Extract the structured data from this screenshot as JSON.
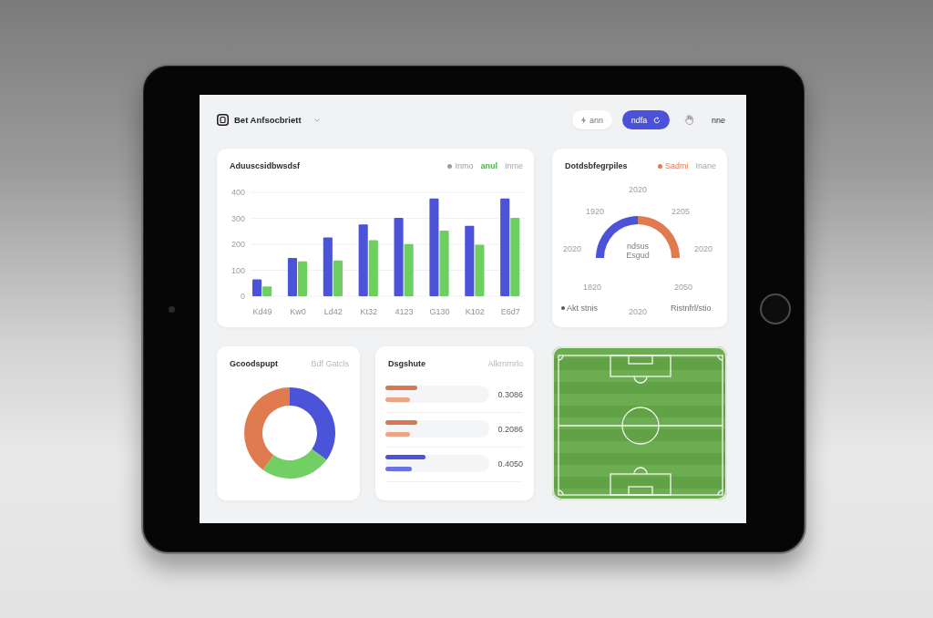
{
  "header": {
    "title": "Bet Anfsocbriett",
    "filter_button": {
      "label": "ann"
    },
    "primary_button": {
      "label": "ndfa"
    },
    "menu": {
      "label": "nne"
    }
  },
  "activity_card": {
    "title": "Aduuscsidbwsdsf",
    "legend": [
      {
        "kind": "marker",
        "label": "Inmo",
        "color": "#9a9ea4",
        "selected": false
      },
      {
        "kind": "plain",
        "label": "anul",
        "selected": true
      },
      {
        "kind": "plain",
        "label": "Inme",
        "selected": false
      }
    ],
    "chart_data": {
      "type": "bar",
      "categories": [
        "Kd49",
        "Kw0",
        "Ld42",
        "Kt32",
        "4123",
        "G130",
        "K102",
        "E6d7"
      ],
      "series": [
        {
          "color": "#4b53d8",
          "values": [
            65,
            147,
            226,
            276,
            302,
            376,
            271,
            376
          ]
        },
        {
          "color": "#6ccf5f",
          "values": [
            38,
            134,
            138,
            216,
            201,
            253,
            198,
            302
          ]
        }
      ],
      "ylim": [
        0,
        400
      ],
      "yticks": [
        0,
        100,
        200,
        300,
        400
      ],
      "grid": true
    }
  },
  "gauge_card": {
    "title": "Dotdsbfegrpiles",
    "legend": [
      {
        "kind": "marker",
        "label": "Sadmi",
        "color": "#e07b50",
        "selected": false
      },
      {
        "kind": "plain",
        "label": "Inane",
        "selected": false
      }
    ],
    "axis_labels": [
      "2020",
      "2205",
      "2020",
      "2050",
      "2020",
      "1820",
      "2020",
      "1920"
    ],
    "center_lines": [
      "ndsus",
      "Esgud"
    ],
    "footer_labels": [
      {
        "kind": "marker",
        "label": "Akt stnis"
      },
      {
        "kind": "plain",
        "label": "Ristnfrl/stio"
      }
    ]
  },
  "donut_card": {
    "title": "Gcoodspupt",
    "subtitle": "Bdf Gatcls",
    "chart_data": {
      "type": "donut",
      "values": [
        35,
        25,
        40
      ],
      "colors": [
        "#4b53d8",
        "#72cf63",
        "#e07b50"
      ]
    }
  },
  "distribution_card": {
    "title": "Dsgshute",
    "subtitle": "Alkrnrnrlo",
    "rows": [
      {
        "value": "0.3086",
        "bars": [
          {
            "level": 0.31,
            "color": "#d9774f"
          },
          {
            "level": 0.24,
            "color": "#eaa584"
          }
        ]
      },
      {
        "value": "0.2086",
        "bars": [
          {
            "level": 0.31,
            "color": "#d9774f"
          },
          {
            "level": 0.24,
            "color": "#eaa584"
          }
        ]
      },
      {
        "value": "0.4050",
        "bars": [
          {
            "level": 0.39,
            "color": "#4b53d8"
          },
          {
            "level": 0.25,
            "color": "#6c73e0"
          }
        ]
      }
    ]
  }
}
